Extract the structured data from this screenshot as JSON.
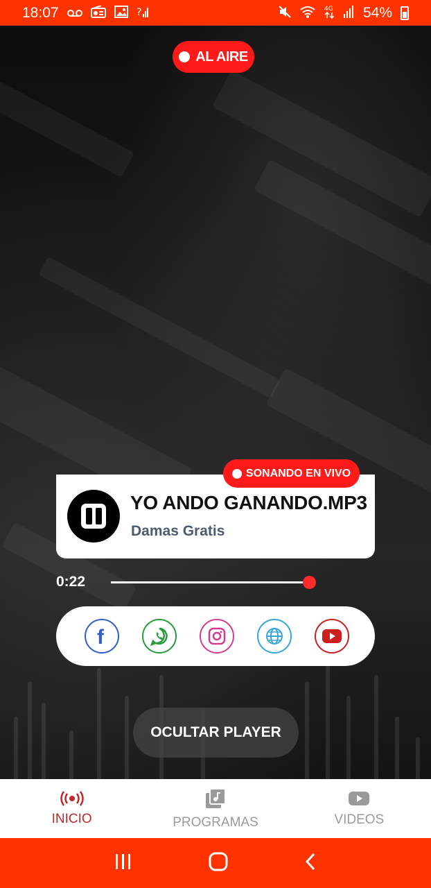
{
  "status_bar": {
    "time": "18:07",
    "battery": "54%",
    "icons_left": [
      "voicemail-icon",
      "radio-icon",
      "image-icon",
      "signal-alert-icon"
    ],
    "icons_right": [
      "mute-icon",
      "wifi-icon",
      "4g-icon",
      "signal-icon",
      "battery-icon"
    ],
    "color": "#ff3300"
  },
  "on_air": {
    "label": "AL AIRE",
    "color": "#ff1a1a"
  },
  "player": {
    "live_badge": "SONANDO EN VIVO",
    "song_title": "YO ANDO GANANDO.MP3",
    "artist": "Damas Gratis",
    "elapsed": "0:22",
    "progress": 0.95
  },
  "social": [
    {
      "name": "facebook",
      "icon": "facebook-icon"
    },
    {
      "name": "whatsapp",
      "icon": "whatsapp-icon"
    },
    {
      "name": "instagram",
      "icon": "instagram-icon"
    },
    {
      "name": "website",
      "icon": "globe-icon"
    },
    {
      "name": "youtube",
      "icon": "youtube-icon"
    }
  ],
  "hide_player_label": "OCULTAR PLAYER",
  "bottom_nav": {
    "items": [
      {
        "label": "INICIO",
        "icon": "broadcast-icon",
        "active": true
      },
      {
        "label": "PROGRAMAS",
        "icon": "music-library-icon",
        "active": false
      },
      {
        "label": "VIDEOS",
        "icon": "youtube-icon",
        "active": false
      }
    ],
    "active_color": "#c1272d"
  },
  "system_nav": [
    "recent-apps-icon",
    "home-icon",
    "back-icon"
  ]
}
